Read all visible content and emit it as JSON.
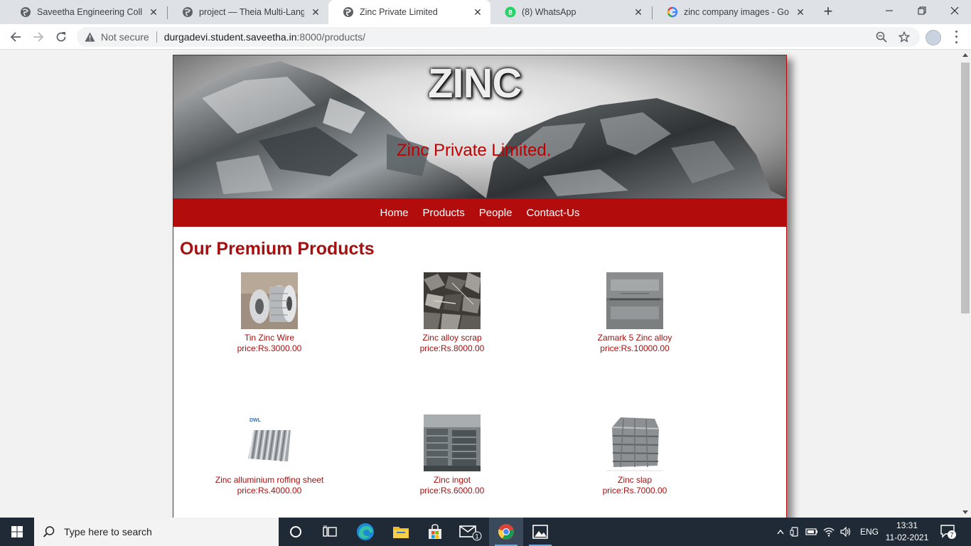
{
  "browser": {
    "tabs": [
      {
        "title": "Saveetha Engineering College",
        "icon": "globe-icon",
        "active": false
      },
      {
        "title": "project — Theia Multi-Language",
        "icon": "globe-icon",
        "active": false
      },
      {
        "title": "Zinc Private Limited",
        "icon": "globe-icon",
        "active": true
      },
      {
        "title": "(8) WhatsApp",
        "icon": "whatsapp-icon",
        "active": false,
        "badge": "8"
      },
      {
        "title": "zinc company images - Google",
        "icon": "google-icon",
        "active": false
      }
    ],
    "new_tab": "+",
    "security_label": "Not secure",
    "url_host": "durgadevi.student.saveetha.in",
    "url_rest": ":8000/products/"
  },
  "site": {
    "banner_logo_text": "ZINC",
    "banner_company": "Zinc Private Limited.",
    "nav": [
      "Home",
      "Products",
      "People",
      "Contact-Us"
    ],
    "heading": "Our Premium Products",
    "products": [
      {
        "name": "Tin Zinc Wire",
        "price": "price:Rs.3000.00",
        "image": "wire-spool"
      },
      {
        "name": "Zinc alloy scrap",
        "price": "price:Rs.8000.00",
        "image": "scrap"
      },
      {
        "name": "Zamark 5 Zinc alloy",
        "price": "price:Rs.10000.00",
        "image": "ingot-bar"
      },
      {
        "name": "Zinc alluminium roffing sheet",
        "price": "price:Rs.4000.00",
        "image": "roof-sheet",
        "image_label": "DWL"
      },
      {
        "name": "Zinc ingot",
        "price": "price:Rs.6000.00",
        "image": "ingot-stack"
      },
      {
        "name": "Zinc slap",
        "price": "price:Rs.7000.00",
        "image": "slab-stack"
      }
    ]
  },
  "taskbar": {
    "search_placeholder": "Type here to search",
    "language": "ENG",
    "time": "13:31",
    "date": "11-02-2021",
    "mail_badge": "1",
    "notification_count": "7"
  },
  "colors": {
    "brand_red": "#b30c0c",
    "text_red": "#a51010"
  }
}
